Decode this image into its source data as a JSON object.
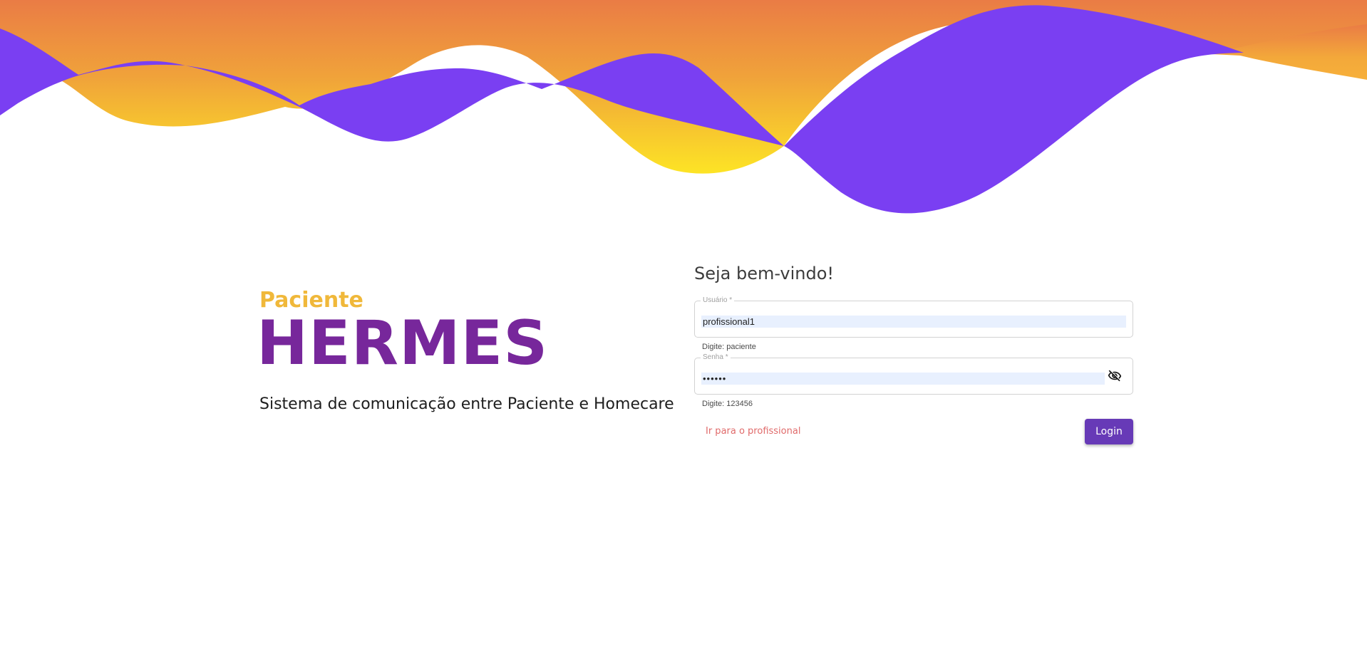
{
  "brand": {
    "subtitle": "Paciente",
    "title": "HERMES",
    "description": "Sistema de comunicação entre Paciente e Homecare"
  },
  "form": {
    "welcome": "Seja bem-vindo!",
    "username": {
      "label": "Usuário *",
      "value": "profissional1",
      "hint": "Digite: paciente"
    },
    "password": {
      "label": "Senha *",
      "value": "••••••",
      "hint": "Digite: 123456",
      "toggle_icon": "eye-off-icon"
    },
    "switch_link": "Ir para o profissional",
    "login_button": "Login"
  },
  "colors": {
    "purple_wave": "#7a3ff2",
    "orange_top": "#ea7c45",
    "yellow": "#fde425",
    "brand_title": "#77279b",
    "brand_subtitle": "#f0b83a",
    "button": "#673ab7",
    "link": "#e06a6a"
  }
}
